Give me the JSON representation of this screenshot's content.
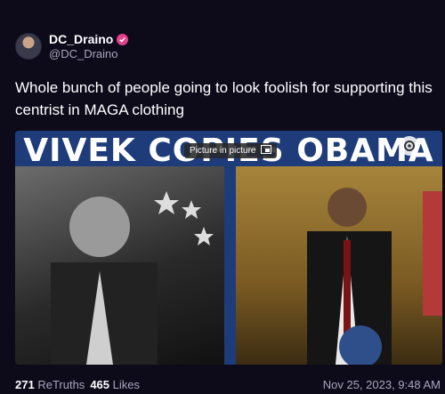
{
  "author": {
    "display_name": "DC_Draino",
    "handle": "@DC_Draino",
    "verified_badge": "verified-check-icon",
    "badge_color": "#e5408a"
  },
  "post": {
    "text": "Whole bunch of people going to look foolish for supporting this centrist in MAGA clothing"
  },
  "media": {
    "headline": "VIVEK COPIES OBAMA",
    "overlay_label": "Picture in picture",
    "overlay_icon": "picture-in-picture-icon",
    "badge_icon": "settings-badge-icon"
  },
  "stats": {
    "retruths_count": "271",
    "retruths_label": "ReTruths",
    "likes_count": "465",
    "likes_label": "Likes"
  },
  "timestamp": "Nov 25, 2023, 9:48 AM",
  "colors": {
    "background": "#0d0b1a",
    "muted_text": "#a8a5bd",
    "banner_blue": "#1f3c7a"
  }
}
